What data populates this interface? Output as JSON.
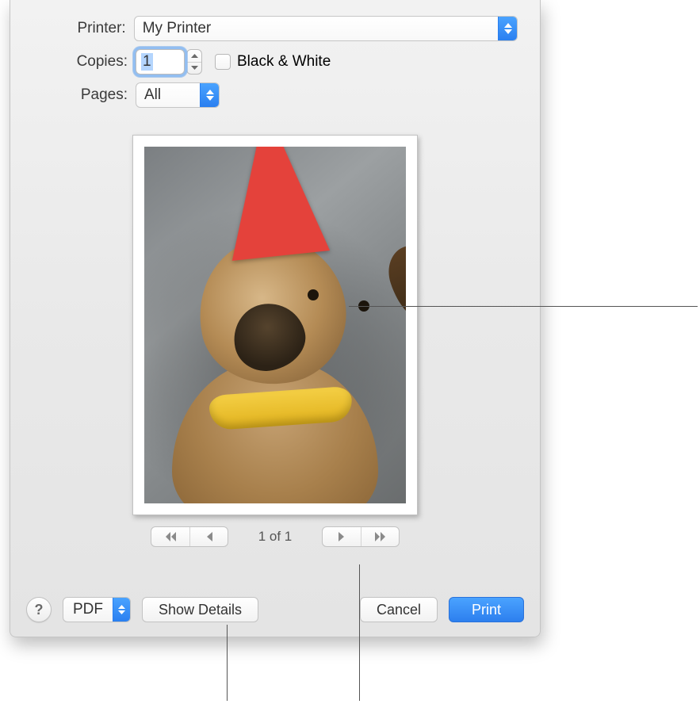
{
  "labels": {
    "printer": "Printer:",
    "copies": "Copies:",
    "pages": "Pages:"
  },
  "printer": {
    "selected": "My Printer"
  },
  "copies": {
    "value": "1"
  },
  "blackwhite": {
    "checked": false,
    "label": "Black & White"
  },
  "pages": {
    "selected": "All"
  },
  "nav": {
    "counter": "1 of 1"
  },
  "bottom": {
    "help_symbol": "?",
    "pdf_label": "PDF",
    "show_details": "Show Details",
    "cancel": "Cancel",
    "print": "Print"
  }
}
